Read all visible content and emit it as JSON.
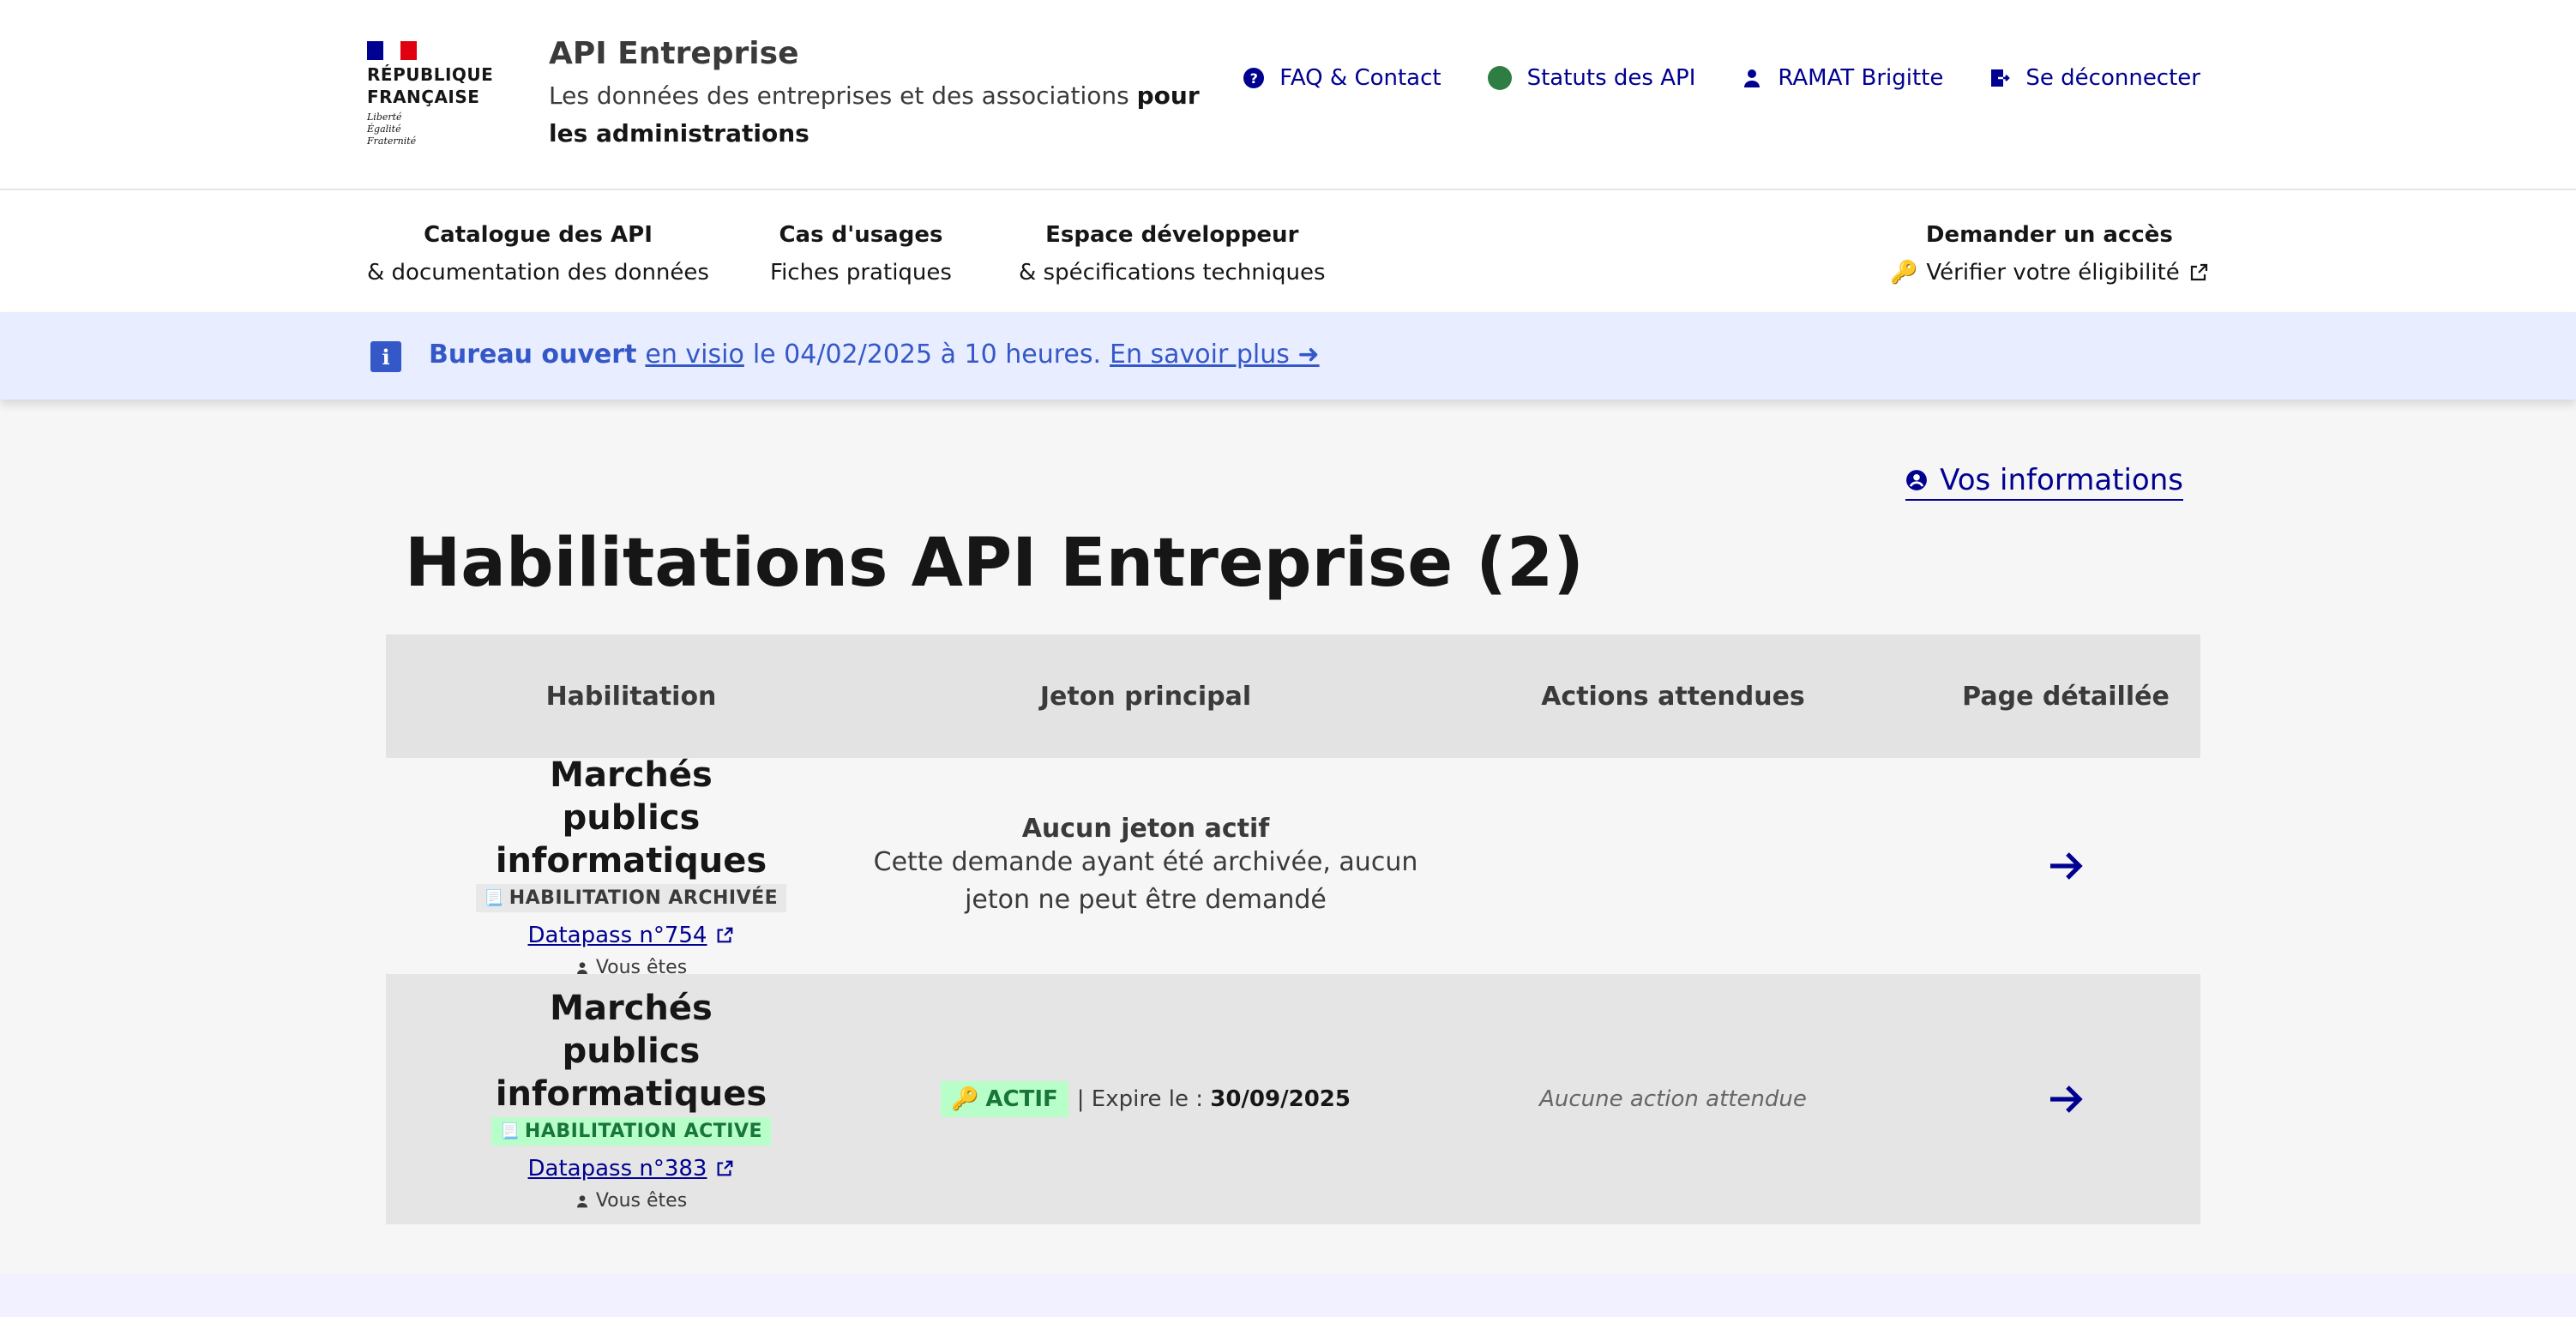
{
  "header": {
    "logo": {
      "line1": "RÉPUBLIQUE",
      "line2": "FRANÇAISE",
      "motto": "Liberté\nÉgalité\nFraternité"
    },
    "title": "API Entreprise",
    "tagline_part1": "Les données des entreprises et des associations ",
    "tagline_bold": "pour les administrations",
    "links": [
      {
        "label": "FAQ & Contact",
        "icon": "question-circle-icon"
      },
      {
        "label": "Statuts des API",
        "icon": "status-dot-icon",
        "color": "#2e7d42"
      },
      {
        "label": "RAMAT Brigitte",
        "icon": "user-icon"
      },
      {
        "label": "Se déconnecter",
        "icon": "logout-icon"
      }
    ]
  },
  "nav": {
    "items": [
      {
        "title": "Catalogue des API",
        "sub": "& documentation des données"
      },
      {
        "title": "Cas d'usages",
        "sub": "Fiches pratiques"
      },
      {
        "title": "Espace développeur",
        "sub": "& spécifications techniques"
      },
      {
        "title": "Demander un accès",
        "sub": "Vérifier votre éligibilité",
        "sub_icon": "🔑"
      }
    ]
  },
  "notice": {
    "bold": "Bureau ouvert",
    "link1": "en visio",
    "text": "le 04/02/2025 à 10 heures.",
    "link2": "En savoir plus ➜",
    "color": "#3558c8"
  },
  "main": {
    "vos_informations": "Vos informations",
    "title": "Habilitations API Entreprise (2)",
    "table": {
      "headers": [
        "Habilitation",
        "Jeton principal",
        "Actions attendues",
        "Page détaillée"
      ],
      "rows": [
        {
          "name": "Marchés publics informatiques",
          "badge": "HABILITATION ARCHIVÉE",
          "badge_icon": "📃",
          "datapass": "Datapass n°754",
          "you": "Vous êtes",
          "token_title": "Aucun jeton actif",
          "token_desc": "Cette demande ayant été archivée, aucun jeton ne peut être demandé",
          "action": ""
        },
        {
          "name": "Marchés publics informatiques",
          "badge": "HABILITATION ACTIVE",
          "badge_icon": "📃",
          "datapass": "Datapass n°383",
          "you": "Vous êtes",
          "token_status": "ACTIF",
          "token_icon": "🔑",
          "expire_label": "| Expire le :",
          "expire_date": "30/09/2025",
          "action": "Aucune action attendue"
        }
      ]
    }
  },
  "colors": {
    "brand_blue": "#000091",
    "active_green": "#18753c",
    "active_bg": "#b8fec9"
  }
}
